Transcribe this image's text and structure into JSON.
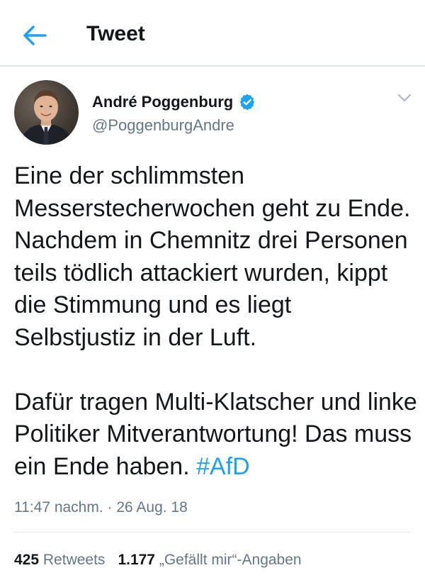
{
  "header": {
    "title": "Tweet",
    "back_icon": "back-arrow-icon",
    "accent_color": "#1da1f2"
  },
  "tweet": {
    "author": {
      "display_name": "André Poggenburg",
      "handle": "@PoggenburgAndre",
      "verified": true
    },
    "paragraphs": [
      "Eine der schlimmsten Messerstecherwochen geht zu Ende. Nachdem in Chemnitz drei Personen teils tödlich attackiert wurden, kippt die Stimmung und es liegt Selbstjustiz in der Luft.",
      "Dafür tragen Multi-Klatscher und linke Politiker Mitverantwortung! Das muss ein Ende haben."
    ],
    "hashtag": "#AfD",
    "timestamp": "11:47 nachm. · 26 Aug. 18",
    "stats": {
      "retweets_count": "425",
      "retweets_label": "Retweets",
      "likes_count": "1.177",
      "likes_label": "„Gefällt mir“-Angaben"
    }
  }
}
